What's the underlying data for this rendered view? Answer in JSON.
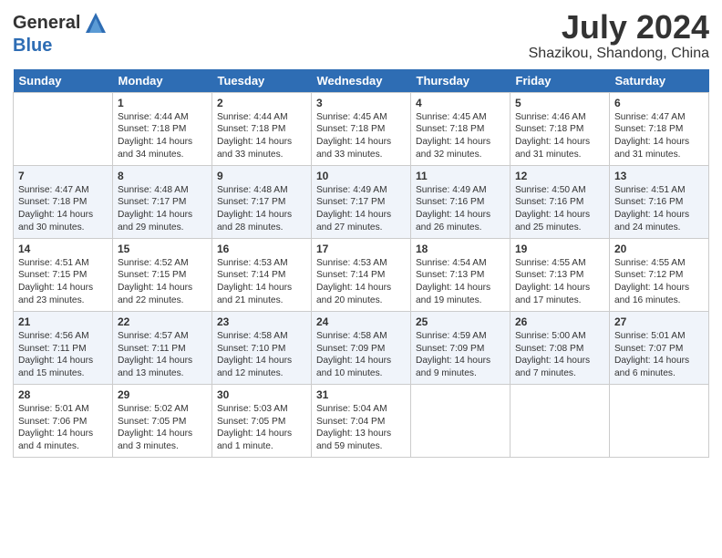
{
  "header": {
    "logo_line1": "General",
    "logo_line2": "Blue",
    "month": "July 2024",
    "location": "Shazikou, Shandong, China"
  },
  "weekdays": [
    "Sunday",
    "Monday",
    "Tuesday",
    "Wednesday",
    "Thursday",
    "Friday",
    "Saturday"
  ],
  "weeks": [
    [
      {
        "day": "",
        "sunrise": "",
        "sunset": "",
        "daylight": ""
      },
      {
        "day": "1",
        "sunrise": "Sunrise: 4:44 AM",
        "sunset": "Sunset: 7:18 PM",
        "daylight": "Daylight: 14 hours and 34 minutes."
      },
      {
        "day": "2",
        "sunrise": "Sunrise: 4:44 AM",
        "sunset": "Sunset: 7:18 PM",
        "daylight": "Daylight: 14 hours and 33 minutes."
      },
      {
        "day": "3",
        "sunrise": "Sunrise: 4:45 AM",
        "sunset": "Sunset: 7:18 PM",
        "daylight": "Daylight: 14 hours and 33 minutes."
      },
      {
        "day": "4",
        "sunrise": "Sunrise: 4:45 AM",
        "sunset": "Sunset: 7:18 PM",
        "daylight": "Daylight: 14 hours and 32 minutes."
      },
      {
        "day": "5",
        "sunrise": "Sunrise: 4:46 AM",
        "sunset": "Sunset: 7:18 PM",
        "daylight": "Daylight: 14 hours and 31 minutes."
      },
      {
        "day": "6",
        "sunrise": "Sunrise: 4:47 AM",
        "sunset": "Sunset: 7:18 PM",
        "daylight": "Daylight: 14 hours and 31 minutes."
      }
    ],
    [
      {
        "day": "7",
        "sunrise": "Sunrise: 4:47 AM",
        "sunset": "Sunset: 7:18 PM",
        "daylight": "Daylight: 14 hours and 30 minutes."
      },
      {
        "day": "8",
        "sunrise": "Sunrise: 4:48 AM",
        "sunset": "Sunset: 7:17 PM",
        "daylight": "Daylight: 14 hours and 29 minutes."
      },
      {
        "day": "9",
        "sunrise": "Sunrise: 4:48 AM",
        "sunset": "Sunset: 7:17 PM",
        "daylight": "Daylight: 14 hours and 28 minutes."
      },
      {
        "day": "10",
        "sunrise": "Sunrise: 4:49 AM",
        "sunset": "Sunset: 7:17 PM",
        "daylight": "Daylight: 14 hours and 27 minutes."
      },
      {
        "day": "11",
        "sunrise": "Sunrise: 4:49 AM",
        "sunset": "Sunset: 7:16 PM",
        "daylight": "Daylight: 14 hours and 26 minutes."
      },
      {
        "day": "12",
        "sunrise": "Sunrise: 4:50 AM",
        "sunset": "Sunset: 7:16 PM",
        "daylight": "Daylight: 14 hours and 25 minutes."
      },
      {
        "day": "13",
        "sunrise": "Sunrise: 4:51 AM",
        "sunset": "Sunset: 7:16 PM",
        "daylight": "Daylight: 14 hours and 24 minutes."
      }
    ],
    [
      {
        "day": "14",
        "sunrise": "Sunrise: 4:51 AM",
        "sunset": "Sunset: 7:15 PM",
        "daylight": "Daylight: 14 hours and 23 minutes."
      },
      {
        "day": "15",
        "sunrise": "Sunrise: 4:52 AM",
        "sunset": "Sunset: 7:15 PM",
        "daylight": "Daylight: 14 hours and 22 minutes."
      },
      {
        "day": "16",
        "sunrise": "Sunrise: 4:53 AM",
        "sunset": "Sunset: 7:14 PM",
        "daylight": "Daylight: 14 hours and 21 minutes."
      },
      {
        "day": "17",
        "sunrise": "Sunrise: 4:53 AM",
        "sunset": "Sunset: 7:14 PM",
        "daylight": "Daylight: 14 hours and 20 minutes."
      },
      {
        "day": "18",
        "sunrise": "Sunrise: 4:54 AM",
        "sunset": "Sunset: 7:13 PM",
        "daylight": "Daylight: 14 hours and 19 minutes."
      },
      {
        "day": "19",
        "sunrise": "Sunrise: 4:55 AM",
        "sunset": "Sunset: 7:13 PM",
        "daylight": "Daylight: 14 hours and 17 minutes."
      },
      {
        "day": "20",
        "sunrise": "Sunrise: 4:55 AM",
        "sunset": "Sunset: 7:12 PM",
        "daylight": "Daylight: 14 hours and 16 minutes."
      }
    ],
    [
      {
        "day": "21",
        "sunrise": "Sunrise: 4:56 AM",
        "sunset": "Sunset: 7:11 PM",
        "daylight": "Daylight: 14 hours and 15 minutes."
      },
      {
        "day": "22",
        "sunrise": "Sunrise: 4:57 AM",
        "sunset": "Sunset: 7:11 PM",
        "daylight": "Daylight: 14 hours and 13 minutes."
      },
      {
        "day": "23",
        "sunrise": "Sunrise: 4:58 AM",
        "sunset": "Sunset: 7:10 PM",
        "daylight": "Daylight: 14 hours and 12 minutes."
      },
      {
        "day": "24",
        "sunrise": "Sunrise: 4:58 AM",
        "sunset": "Sunset: 7:09 PM",
        "daylight": "Daylight: 14 hours and 10 minutes."
      },
      {
        "day": "25",
        "sunrise": "Sunrise: 4:59 AM",
        "sunset": "Sunset: 7:09 PM",
        "daylight": "Daylight: 14 hours and 9 minutes."
      },
      {
        "day": "26",
        "sunrise": "Sunrise: 5:00 AM",
        "sunset": "Sunset: 7:08 PM",
        "daylight": "Daylight: 14 hours and 7 minutes."
      },
      {
        "day": "27",
        "sunrise": "Sunrise: 5:01 AM",
        "sunset": "Sunset: 7:07 PM",
        "daylight": "Daylight: 14 hours and 6 minutes."
      }
    ],
    [
      {
        "day": "28",
        "sunrise": "Sunrise: 5:01 AM",
        "sunset": "Sunset: 7:06 PM",
        "daylight": "Daylight: 14 hours and 4 minutes."
      },
      {
        "day": "29",
        "sunrise": "Sunrise: 5:02 AM",
        "sunset": "Sunset: 7:05 PM",
        "daylight": "Daylight: 14 hours and 3 minutes."
      },
      {
        "day": "30",
        "sunrise": "Sunrise: 5:03 AM",
        "sunset": "Sunset: 7:05 PM",
        "daylight": "Daylight: 14 hours and 1 minute."
      },
      {
        "day": "31",
        "sunrise": "Sunrise: 5:04 AM",
        "sunset": "Sunset: 7:04 PM",
        "daylight": "Daylight: 13 hours and 59 minutes."
      },
      {
        "day": "",
        "sunrise": "",
        "sunset": "",
        "daylight": ""
      },
      {
        "day": "",
        "sunrise": "",
        "sunset": "",
        "daylight": ""
      },
      {
        "day": "",
        "sunrise": "",
        "sunset": "",
        "daylight": ""
      }
    ]
  ]
}
